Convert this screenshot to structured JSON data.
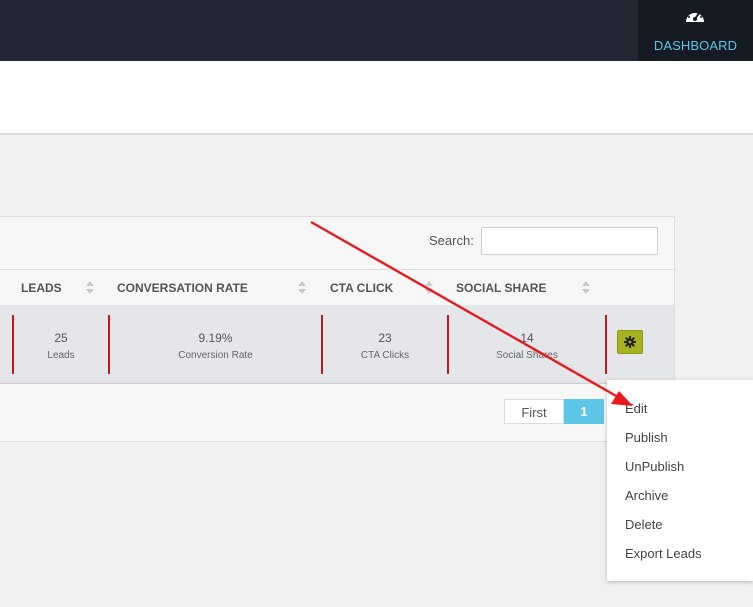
{
  "header": {
    "dashboard_label": "DASHBOARD",
    "dashboard_icon": "speedometer-icon",
    "accent": "#5bc6e8"
  },
  "table": {
    "search_label": "Search:",
    "search_value": "",
    "columns": [
      "LEADS",
      "CONVERSATION RATE",
      "CTA CLICK",
      "SOCIAL SHARE"
    ],
    "row": {
      "leads_value": "25",
      "leads_sub": "Leads",
      "rate_value": "9.19%",
      "rate_sub": "Conversion Rate",
      "cta_value": "23",
      "cta_sub": "CTA Clicks",
      "share_value": "14",
      "share_sub": "Social Shares",
      "actions_icon": "gear-icon"
    }
  },
  "pagination": {
    "first_label": "First",
    "current_page": "1"
  },
  "action_menu": {
    "items": [
      "Edit",
      "Publish",
      "UnPublish",
      "Archive",
      "Delete",
      "Export Leads"
    ]
  },
  "annotation": {
    "arrow_color": "#e8191b"
  }
}
